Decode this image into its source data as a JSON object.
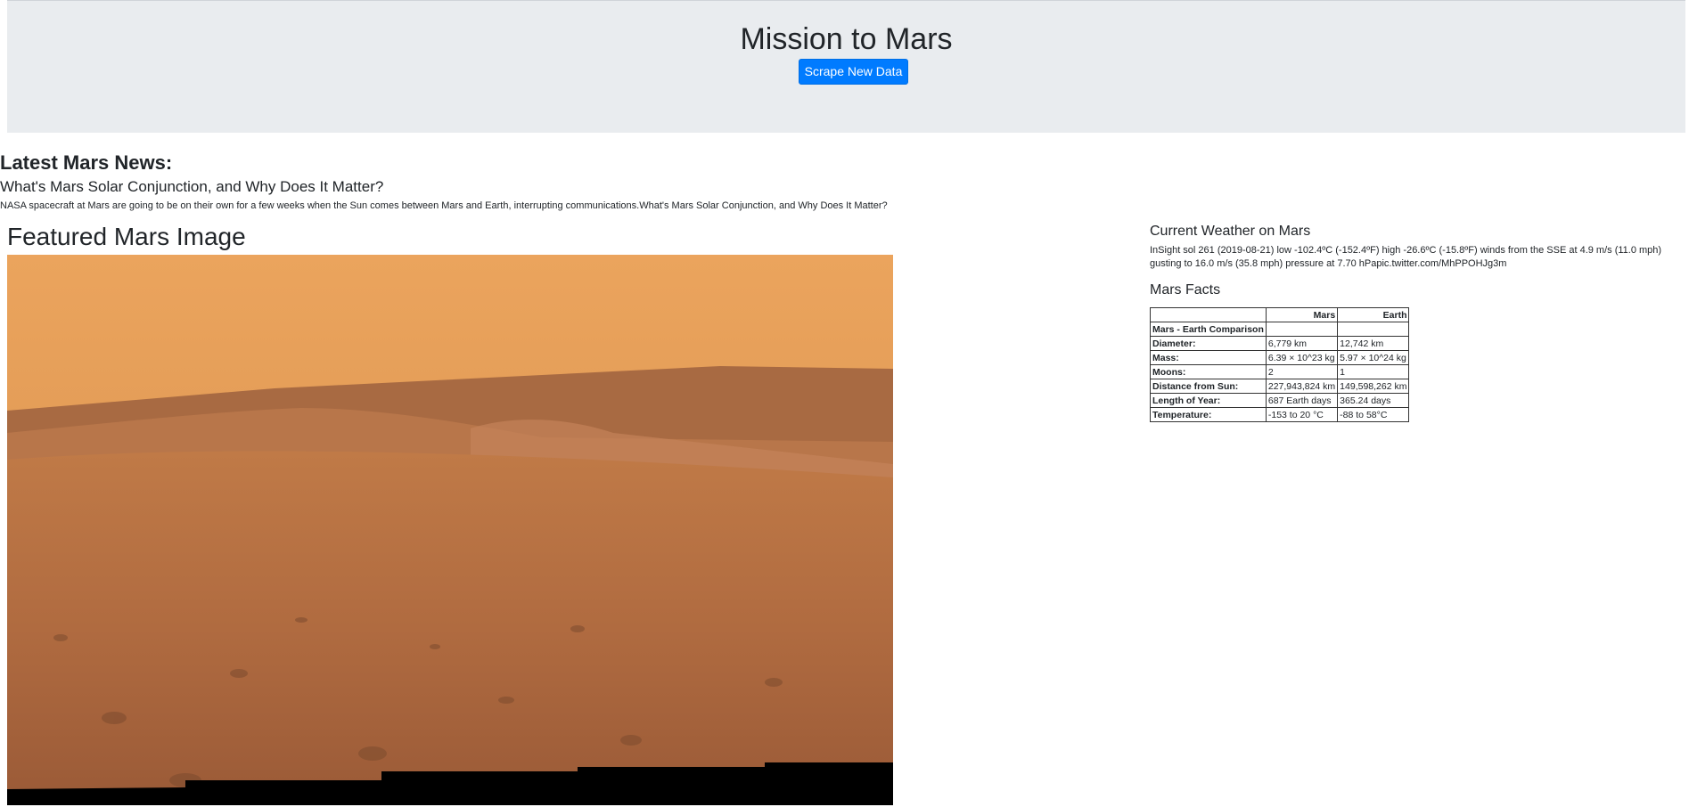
{
  "header": {
    "title": "Mission to Mars",
    "scrape_button_label": "Scrape New Data"
  },
  "news": {
    "section_heading": "Latest Mars News:",
    "title": "What's Mars Solar Conjunction, and Why Does It Matter?",
    "paragraph": "NASA spacecraft at Mars are going to be on their own for a few weeks when the Sun comes between Mars and Earth, interrupting communications.What's Mars Solar Conjunction, and Why Does It Matter?"
  },
  "featured": {
    "heading": "Featured Mars Image"
  },
  "weather": {
    "heading": "Current Weather on Mars",
    "text": "InSight sol 261 (2019-08-21) low -102.4ºC (-152.4ºF) high -26.6ºC (-15.8ºF) winds from the SSE at 4.9 m/s (11.0 mph) gusting to 16.0 m/s (35.8 mph) pressure at 7.70 hPapic.twitter.com/MhPPOHJg3m"
  },
  "facts": {
    "heading": "Mars Facts",
    "columns": [
      "",
      "Mars",
      "Earth"
    ],
    "rows": [
      {
        "label": "Mars - Earth Comparison",
        "mars": "",
        "earth": ""
      },
      {
        "label": "Diameter:",
        "mars": "6,779 km",
        "earth": "12,742 km"
      },
      {
        "label": "Mass:",
        "mars": "6.39 × 10^23 kg",
        "earth": "5.97 × 10^24 kg"
      },
      {
        "label": "Moons:",
        "mars": "2",
        "earth": "1"
      },
      {
        "label": "Distance from Sun:",
        "mars": "227,943,824 km",
        "earth": "149,598,262 km"
      },
      {
        "label": "Length of Year:",
        "mars": "687 Earth days",
        "earth": "365.24 days"
      },
      {
        "label": "Temperature:",
        "mars": "-153 to 20 °C",
        "earth": "-88 to 58°C"
      }
    ]
  },
  "colors": {
    "primary_button": "#007bff",
    "jumbotron_bg": "#e9ecef"
  }
}
